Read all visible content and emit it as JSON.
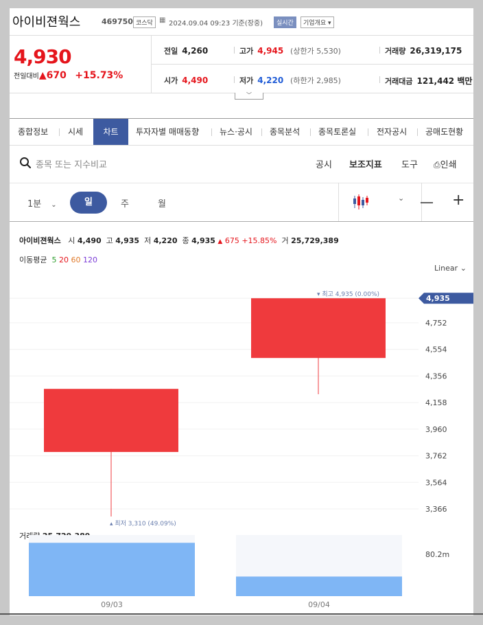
{
  "header": {
    "stock_name": "아이비젼웍스",
    "stock_code": "469750",
    "market_badge": "코스닥",
    "timestamp": "2024.09.04 09:23",
    "basis": "기준(장중)",
    "realtime_badge": "실시간",
    "company_overview": "기업개요"
  },
  "price": {
    "current": "4,930",
    "change_label": "전일대비",
    "change_arrow": "▲",
    "change": "670",
    "change_pct": "+15.73%"
  },
  "info": {
    "prev_close_label": "전일",
    "prev_close": "4,260",
    "high_label": "고가",
    "high": "4,945",
    "upper_limit": "(상한가 5,530)",
    "volume_label": "거래량",
    "volume": "26,319,175",
    "open_label": "시가",
    "open": "4,490",
    "low_label": "저가",
    "low": "4,220",
    "lower_limit": "(하한가 2,985)",
    "amount_label": "거래대금",
    "amount": "121,442 백만"
  },
  "tabs": [
    "종합정보",
    "시세",
    "차트",
    "투자자별 매매동향",
    "뉴스·공시",
    "종목분석",
    "종목토론실",
    "전자공시",
    "공매도현황"
  ],
  "active_tab": 2,
  "search": {
    "placeholder": "종목 또는 지수비교"
  },
  "tools": {
    "disclosure": "공시",
    "indicator": "보조지표",
    "tool": "도구",
    "print": "인쇄"
  },
  "periods": {
    "minute": "1분",
    "day": "일",
    "week": "주",
    "month": "월"
  },
  "summary": {
    "name": "아이비젼웍스",
    "open_label": "시",
    "open": "4,490",
    "high_label": "고",
    "high": "4,935",
    "low_label": "저",
    "low": "4,220",
    "close_label": "종",
    "close": "4,935",
    "arrow": "▲",
    "change": "675",
    "pct": "+15.85%",
    "vol_label": "거",
    "volume": "25,729,389"
  },
  "moving_average": {
    "label": "이동평균",
    "p5": "5",
    "p20": "20",
    "p60": "60",
    "p120": "120"
  },
  "scale_mode": "Linear",
  "colors": {
    "up": "#ef3a3d",
    "accent": "#3d5aa0",
    "volume": "#7fb6f5",
    "ma5": "#2e9e2e",
    "ma20": "#e5151c",
    "ma60": "#e07a2a",
    "ma120": "#7a3ad6"
  },
  "chart_data": {
    "type": "candlestick",
    "y_ticks": [
      4752,
      4554,
      4356,
      4158,
      3960,
      3762,
      3564,
      3366
    ],
    "y_tick_labels": [
      "4,752",
      "4,554",
      "4,356",
      "4,158",
      "3,960",
      "3,762",
      "3,564",
      "3,366"
    ],
    "current_price_label": "4,935",
    "x_labels": [
      "09/03",
      "09/04"
    ],
    "candles": [
      {
        "date": "09/03",
        "open": 3790,
        "high": 4260,
        "low": 3310,
        "close": 4260
      },
      {
        "date": "09/04",
        "open": 4490,
        "high": 4935,
        "low": 4220,
        "close": 4935
      }
    ],
    "max_annotation": "최고 4,935 (0.00%)",
    "min_annotation": "최저 3,310 (49.09%)",
    "volume": {
      "label": "거래량",
      "value_label": "25,729,389",
      "axis_label": "80.2m",
      "axis_max": 80200000,
      "values": [
        70000000,
        25729389
      ]
    }
  }
}
